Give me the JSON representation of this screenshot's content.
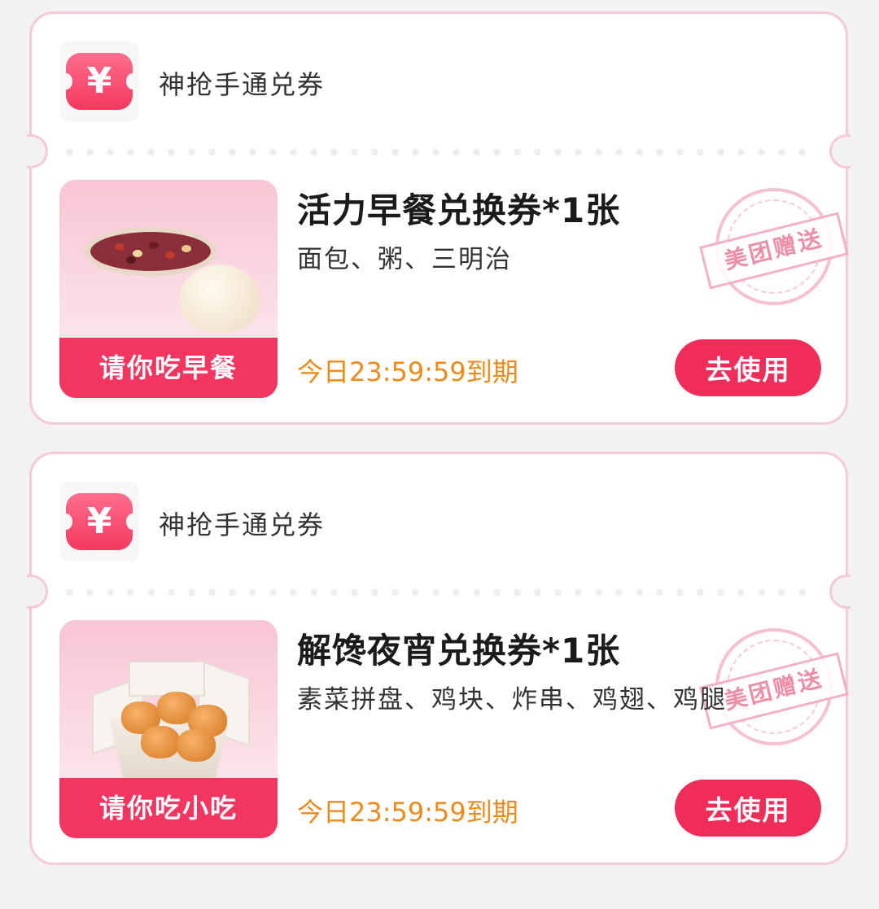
{
  "cards": [
    {
      "brand": "神抢手通兑券",
      "ribbon": "请你吃早餐",
      "title": "活力早餐兑换券*1张",
      "subtitle": "面包、粥、三明治",
      "expire": "今日23:59:59到期",
      "button": "去使用",
      "stamp": "美团赠送",
      "image": "congee-and-bun"
    },
    {
      "brand": "神抢手通兑券",
      "ribbon": "请你吃小吃",
      "title": "解馋夜宵兑换券*1张",
      "subtitle": "素菜拼盘、鸡块、炸串、鸡翅、鸡腿",
      "expire": "今日23:59:59到期",
      "button": "去使用",
      "stamp": "美团赠送",
      "image": "fried-chicken-box"
    }
  ],
  "icon": {
    "symbol": "¥",
    "name": "yen-ticket-icon"
  },
  "colors": {
    "accent": "#f02d58",
    "expire": "#ee8a1a",
    "border": "#f6c9d6"
  }
}
